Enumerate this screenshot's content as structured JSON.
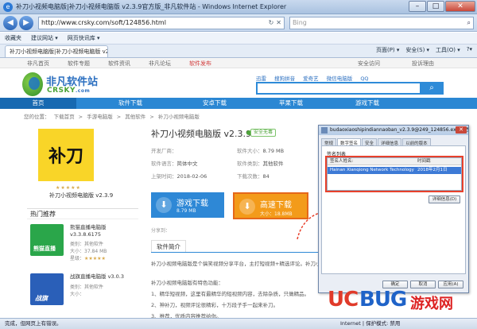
{
  "browser": {
    "title": "补刀小视频电脑版|补刀小视频电脑版 v2.3.9官方版_非凡软件站 - Windows Internet Explorer",
    "window_controls": [
      "–",
      "□",
      "✕"
    ],
    "back": "◀",
    "forward": "▶",
    "url": "http://www.crsky.com/soft/124856.html",
    "search_placeholder": "Bing",
    "favorites_items": [
      "收藏夹",
      "建议网站 ▾",
      "网页快讯库 ▾"
    ],
    "tab_title": "补刀小视频电脑版|补刀小视频电脑版 v2.3.9...",
    "commands": [
      "页面(P) ▾",
      "安全(S) ▾",
      "工具(O) ▾",
      "?▾"
    ],
    "status_left": "完成，但网页上有错误。",
    "status_right": "Internet | 保护模式: 禁用"
  },
  "site": {
    "topnav": [
      "非凡首页",
      "软件专题",
      "软件资讯",
      "非凡论坛",
      "软件发布"
    ],
    "topnav_right": [
      "安全访问",
      "投诉理由"
    ],
    "logo_zh": "非凡软件站",
    "logo_en": "CRSKY",
    "logo_en_suffix": ".com",
    "hot_searches": [
      "迅雷",
      "搜狗拼音",
      "爱奇艺",
      "微信电脑版",
      "QQ"
    ],
    "search_button": "⌕",
    "mainnav": [
      "首页",
      "软件下载",
      "安卓下载",
      "苹果下载",
      "游戏下载"
    ],
    "breadcrumb": [
      "您的位置：",
      "下载首页",
      ">",
      "手游电脑版",
      ">",
      "其他软件",
      ">",
      "补刀小视频电脑版"
    ]
  },
  "app": {
    "icon_text": "补刀",
    "stars": "★★★★★",
    "name_left": "补刀小视频电脑版 v2.3.9",
    "title": "补刀小视频电脑版 v2.3.9",
    "safe_badge": "安全无毒",
    "rows": [
      {
        "k1": "开发厂商：",
        "v1": "",
        "k2": "软件大小：",
        "v2": "8.79 MB"
      },
      {
        "k1": "软件语言：",
        "v1": "简体中文",
        "k2": "软件类别：",
        "v2": "其他软件"
      },
      {
        "k1": "上架时间：",
        "v1": "2018-02-06",
        "k2": "下载次数：",
        "v2": "84"
      }
    ],
    "download_game": "游戏下载",
    "download_game_size": "8.79 MB",
    "download_fast": "高速下载",
    "download_fast_size": "大小：18.8MB",
    "share_label": "分享到：",
    "intro_tab": "软件简介",
    "intro_lines": [
      "补刀小视频电脑版是个搞笑视频分享平台，主打短视频+精选评论。补刀小视频",
      "",
      "补刀小视频电脑版有特色功能：",
      "1、精华短视频，这里有最精华的短视频内容，去除杂质，只做精品。",
      "2、神补刀，视频评论很精彩，十万段子手一起来补刀。",
      "3、推荐，优质内容推荐给你。"
    ]
  },
  "hot_recommend": {
    "title": "热门推荐",
    "items": [
      {
        "name": "熊猫直播电脑版 v3.3.8.6175",
        "category": "类别：其他软件",
        "size": "大小：37.84 MB",
        "rating_label": "星级：",
        "rating": "★★★★★",
        "thumb_text": "熊猫直播",
        "thumb_color": "#2aa64a"
      },
      {
        "name": "战旗直播电脑版 v3.0.3",
        "category": "类别：其他软件",
        "size": "大小：",
        "rating_label": "",
        "rating": "",
        "thumb_text": "战旗",
        "thumb_color": "#2a5fb8"
      }
    ]
  },
  "dialog": {
    "title": "budaoxiaoshipindiannaoban_v2.3.9@249_124856.exe 属性",
    "close": "✕",
    "tabs": [
      "常规",
      "数字签名",
      "安全",
      "详细信息",
      "以前的版本"
    ],
    "active_tab": 1,
    "siglist_label": "签名列表",
    "col_name": "签名人姓名:",
    "col_time": "时间戳",
    "signer": "Hainan Xianqiong Network Technology",
    "timestamp": "2018年2月1日",
    "details_button": "详细信息(D)",
    "buttons": [
      "确定",
      "取消",
      "应用(A)"
    ]
  },
  "watermark": {
    "uc": "UC",
    "bug": "BUG",
    "zh": "游戏网"
  }
}
